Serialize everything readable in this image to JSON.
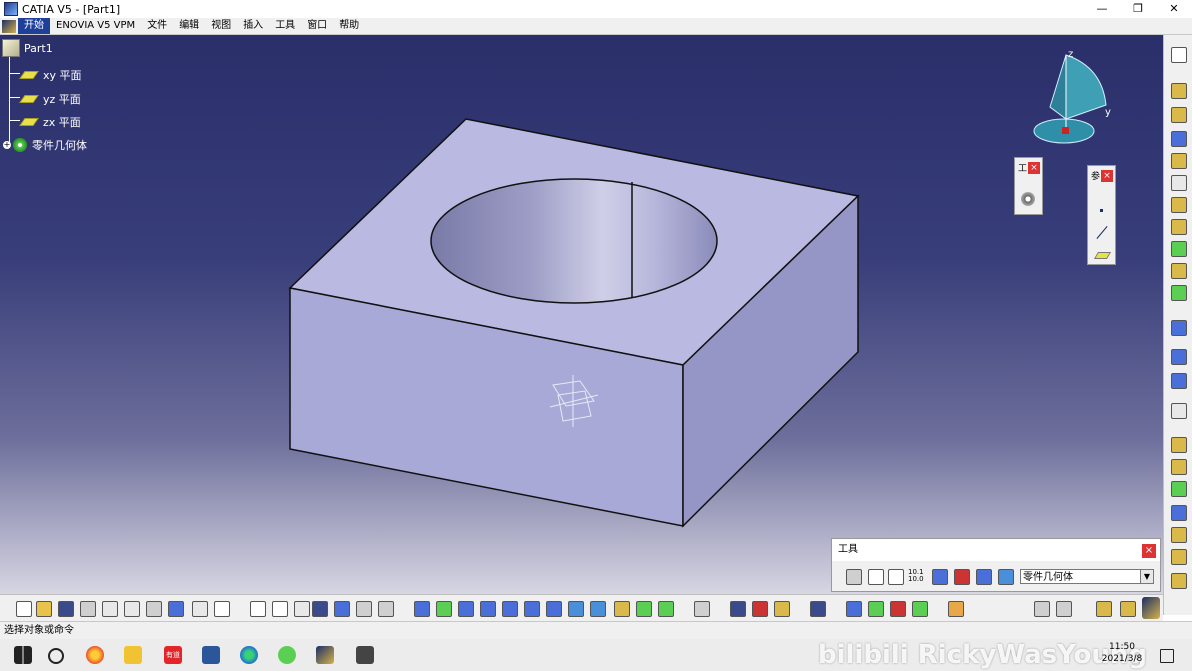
{
  "window": {
    "title": "CATIA V5 - [Part1]",
    "minimize": "—",
    "maximize": "❐",
    "close": "✕"
  },
  "menu": {
    "items": [
      "开始",
      "ENOVIA V5 VPM",
      "文件",
      "编辑",
      "视图",
      "插入",
      "工具",
      "窗口",
      "帮助"
    ]
  },
  "tree": {
    "root": "Part1",
    "planes": [
      "xy 平面",
      "yz 平面",
      "zx 平面"
    ],
    "body": "零件几何体"
  },
  "compass": {
    "z_label": "z",
    "y_label": "y"
  },
  "floating_toolbar_1": {
    "title": "工",
    "close": "×"
  },
  "floating_toolbar_2": {
    "title": "参",
    "close": "×"
  },
  "tools_panel": {
    "title": "工具",
    "close": "×",
    "selected_body": "零件几何体",
    "dropdown_arrow": "▼",
    "coords_label": "10.1 10.0"
  },
  "statusbar": {
    "text": "选择对象或命令"
  },
  "taskbar": {
    "time": "11:50",
    "date": "2021/3/8",
    "youdao_label": "有道",
    "watermark": "bilibili RickyWasYoung"
  },
  "colors": {
    "viewport_top": "#2a2f6a",
    "box_top": "#b8b8e0",
    "box_front": "#a7a7d6",
    "box_right": "#8f8fc0",
    "menu_start": "#1e3f9a"
  }
}
